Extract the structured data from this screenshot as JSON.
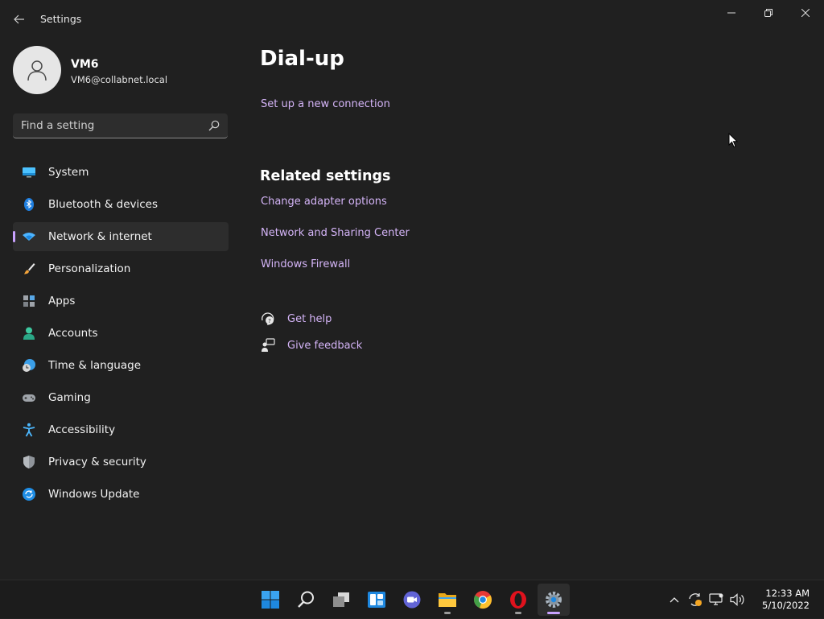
{
  "window": {
    "app_title": "Settings"
  },
  "profile": {
    "name": "VM6",
    "email": "VM6@collabnet.local"
  },
  "search": {
    "placeholder": "Find a setting"
  },
  "nav": {
    "items": [
      {
        "label": "System",
        "icon": "system-icon"
      },
      {
        "label": "Bluetooth & devices",
        "icon": "bluetooth-icon"
      },
      {
        "label": "Network & internet",
        "icon": "wifi-icon",
        "active": true
      },
      {
        "label": "Personalization",
        "icon": "brush-icon"
      },
      {
        "label": "Apps",
        "icon": "apps-icon"
      },
      {
        "label": "Accounts",
        "icon": "person-icon"
      },
      {
        "label": "Time & language",
        "icon": "clock-globe-icon"
      },
      {
        "label": "Gaming",
        "icon": "gamepad-icon"
      },
      {
        "label": "Accessibility",
        "icon": "accessibility-icon"
      },
      {
        "label": "Privacy & security",
        "icon": "shield-icon"
      },
      {
        "label": "Windows Update",
        "icon": "update-icon"
      }
    ]
  },
  "main": {
    "title": "Dial-up",
    "setup_link": "Set up a new connection",
    "related_title": "Related settings",
    "related_links": [
      "Change adapter options",
      "Network and Sharing Center",
      "Windows Firewall"
    ],
    "help_label": "Get help",
    "feedback_label": "Give feedback"
  },
  "taskbar": {
    "apps": [
      "start-icon",
      "search-icon",
      "task-view-icon",
      "widgets-icon",
      "chat-icon",
      "file-explorer-icon",
      "chrome-icon",
      "opera-icon",
      "settings-icon"
    ],
    "clock": {
      "time": "12:33 AM",
      "date": "5/10/2022"
    }
  },
  "colors": {
    "background": "#202020",
    "link": "#d4b4f7",
    "accent": "#c9a2ff"
  }
}
